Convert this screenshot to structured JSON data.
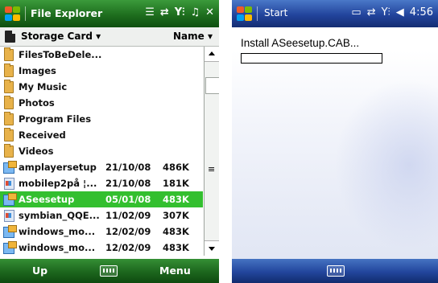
{
  "left": {
    "title": "File Explorer",
    "status_icons": [
      "menu-lines-icon",
      "sync-arrows-icon",
      "signal-icon",
      "sound-icon",
      "close-icon"
    ],
    "close_label": "✕",
    "location": "Storage Card",
    "sort": "Name",
    "files": [
      {
        "name": "FilesToBeDele...",
        "date": "",
        "size": "",
        "icon": "folder-icon"
      },
      {
        "name": "Images",
        "date": "",
        "size": "",
        "icon": "folder-icon"
      },
      {
        "name": "My Music",
        "date": "",
        "size": "",
        "icon": "folder-icon"
      },
      {
        "name": "Photos",
        "date": "",
        "size": "",
        "icon": "folder-icon"
      },
      {
        "name": "Program Files",
        "date": "",
        "size": "",
        "icon": "folder-icon"
      },
      {
        "name": "Received",
        "date": "",
        "size": "",
        "icon": "folder-icon"
      },
      {
        "name": "Videos",
        "date": "",
        "size": "",
        "icon": "folder-icon"
      },
      {
        "name": "amplayersetup",
        "date": "21/10/08",
        "size": "486K",
        "icon": "cab-icon"
      },
      {
        "name": "mobilep2på ¦...",
        "date": "21/10/08",
        "size": "181K",
        "icon": "file-icon"
      },
      {
        "name": "ASeesetup",
        "date": "05/01/08",
        "size": "483K",
        "icon": "cab-icon",
        "selected": true
      },
      {
        "name": "symbian_QQE...",
        "date": "11/02/09",
        "size": "307K",
        "icon": "file-icon"
      },
      {
        "name": "windows_mo...",
        "date": "12/02/09",
        "size": "483K",
        "icon": "cab-icon"
      },
      {
        "name": "windows_mo...",
        "date": "12/02/09",
        "size": "483K",
        "icon": "cab-icon"
      }
    ],
    "softkeys": {
      "left": "Up",
      "right": "Menu"
    }
  },
  "right": {
    "title": "Start",
    "time": "4:56",
    "status_icons": [
      "battery-icon",
      "sync-arrows-icon",
      "signal-icon",
      "speaker-icon"
    ],
    "install_text": "Install ASeesetup.CAB...",
    "progress": 0.0
  },
  "colors": {
    "green_bar": "#1e6e1e",
    "blue_bar": "#22449c",
    "selection": "#33bf2f"
  }
}
